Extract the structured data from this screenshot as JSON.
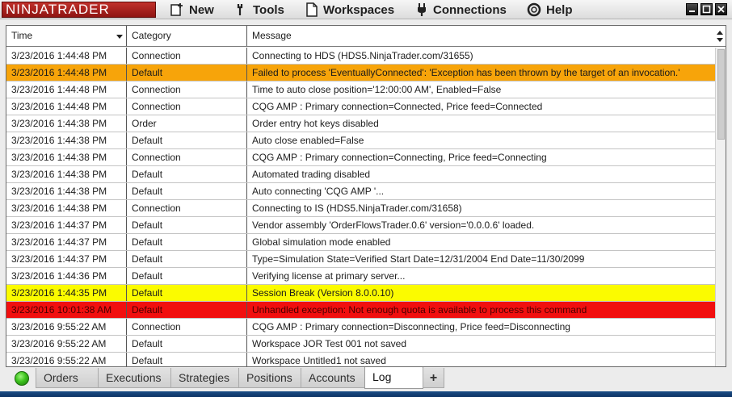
{
  "app": {
    "logo_text": "NINJATRADER",
    "brand_color": "#a31d19"
  },
  "menu": {
    "new": "New",
    "tools": "Tools",
    "workspaces": "Workspaces",
    "connections": "Connections",
    "help": "Help"
  },
  "grid": {
    "columns": [
      "Time",
      "Category",
      "Message"
    ],
    "sorted_column": "Time",
    "rows": [
      {
        "time": "3/23/2016 1:44:48 PM",
        "category": "Connection",
        "message": "Connecting to HDS (HDS5.NinjaTrader.com/31655)",
        "highlight": "white"
      },
      {
        "time": "3/23/2016 1:44:48 PM",
        "category": "Default",
        "message": "Failed to process 'EventuallyConnected': 'Exception has been thrown by the target of an invocation.'",
        "highlight": "orange"
      },
      {
        "time": "3/23/2016 1:44:48 PM",
        "category": "Connection",
        "message": "Time to auto close position='12:00:00 AM', Enabled=False",
        "highlight": "white"
      },
      {
        "time": "3/23/2016 1:44:48 PM",
        "category": "Connection",
        "message": "CQG AMP : Primary connection=Connected, Price feed=Connected",
        "highlight": "white"
      },
      {
        "time": "3/23/2016 1:44:38 PM",
        "category": "Order",
        "message": "Order entry hot keys disabled",
        "highlight": "white"
      },
      {
        "time": "3/23/2016 1:44:38 PM",
        "category": "Default",
        "message": "Auto close enabled=False",
        "highlight": "white"
      },
      {
        "time": "3/23/2016 1:44:38 PM",
        "category": "Connection",
        "message": "CQG AMP : Primary connection=Connecting, Price feed=Connecting",
        "highlight": "white"
      },
      {
        "time": "3/23/2016 1:44:38 PM",
        "category": "Default",
        "message": "Automated trading disabled",
        "highlight": "white"
      },
      {
        "time": "3/23/2016 1:44:38 PM",
        "category": "Default",
        "message": "Auto connecting 'CQG AMP '...",
        "highlight": "white"
      },
      {
        "time": "3/23/2016 1:44:38 PM",
        "category": "Connection",
        "message": "Connecting to IS (HDS5.NinjaTrader.com/31658)",
        "highlight": "white"
      },
      {
        "time": "3/23/2016 1:44:37 PM",
        "category": "Default",
        "message": "Vendor assembly 'OrderFlowsTrader.0.6' version='0.0.0.6' loaded.",
        "highlight": "white"
      },
      {
        "time": "3/23/2016 1:44:37 PM",
        "category": "Default",
        "message": "Global simulation mode enabled",
        "highlight": "white"
      },
      {
        "time": "3/23/2016 1:44:37 PM",
        "category": "Default",
        "message": "Type=Simulation State=Verified Start Date=12/31/2004 End Date=11/30/2099",
        "highlight": "white"
      },
      {
        "time": "3/23/2016 1:44:36 PM",
        "category": "Default",
        "message": "Verifying license at primary server...",
        "highlight": "white"
      },
      {
        "time": "3/23/2016 1:44:35 PM",
        "category": "Default",
        "message": "Session Break (Version 8.0.0.10)",
        "highlight": "yellow"
      },
      {
        "time": "3/23/2016 10:01:38 AM",
        "category": "Default",
        "message": "Unhandled exception: Not enough quota is available to process this command",
        "highlight": "red"
      },
      {
        "time": "3/23/2016 9:55:22 AM",
        "category": "Connection",
        "message": "CQG AMP : Primary connection=Disconnecting, Price feed=Disconnecting",
        "highlight": "white"
      },
      {
        "time": "3/23/2016 9:55:22 AM",
        "category": "Default",
        "message": "Workspace JOR  Test 001 not saved",
        "highlight": "white"
      },
      {
        "time": "3/23/2016 9:55:22 AM",
        "category": "Default",
        "message": "Workspace Untitled1 not saved",
        "highlight": "white"
      }
    ]
  },
  "tabs": {
    "items": [
      "Orders",
      "Executions",
      "Strategies",
      "Positions",
      "Accounts",
      "Log"
    ],
    "active": "Log",
    "add_label": "+"
  },
  "status": {
    "connection_indicator_color": "#3cc21d"
  }
}
